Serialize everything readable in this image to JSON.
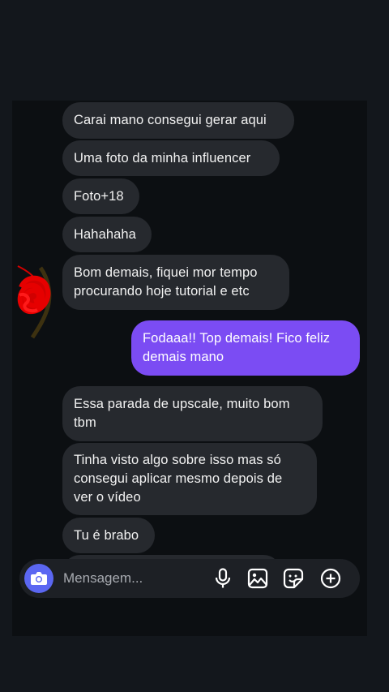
{
  "conversation": {
    "messages": [
      {
        "direction": "in",
        "text": "Carai mano consegui gerar aqui"
      },
      {
        "direction": "in",
        "text": "Uma foto da minha influencer"
      },
      {
        "direction": "in",
        "text": "Foto+18"
      },
      {
        "direction": "in",
        "text": "Hahahaha"
      },
      {
        "direction": "in",
        "text": "Bom demais, fiquei mor tempo\nprocurando hoje tutorial e etc"
      },
      {
        "direction": "out",
        "text": "Fodaaa!! Top demais! Fico feliz\ndemais mano"
      },
      {
        "direction": "in",
        "text": "Essa parada de upscale, muito bom\ntbm"
      },
      {
        "direction": "in",
        "text": "Tinha visto algo sobre isso mas só\nconsegui aplicar mesmo depois de\nver o vídeo"
      },
      {
        "direction": "in",
        "text": "Tu é brabo"
      }
    ]
  },
  "composer": {
    "placeholder": "Mensagem...",
    "icons": [
      "camera-icon",
      "microphone-icon",
      "gallery-icon",
      "sticker-icon",
      "add-icon"
    ]
  },
  "colors": {
    "background": "#13171c",
    "chat_background": "#0c0f12",
    "incoming_bubble": "#26292e",
    "outgoing_bubble": "#7b4cf3",
    "camera_button": "#5b67f2"
  }
}
